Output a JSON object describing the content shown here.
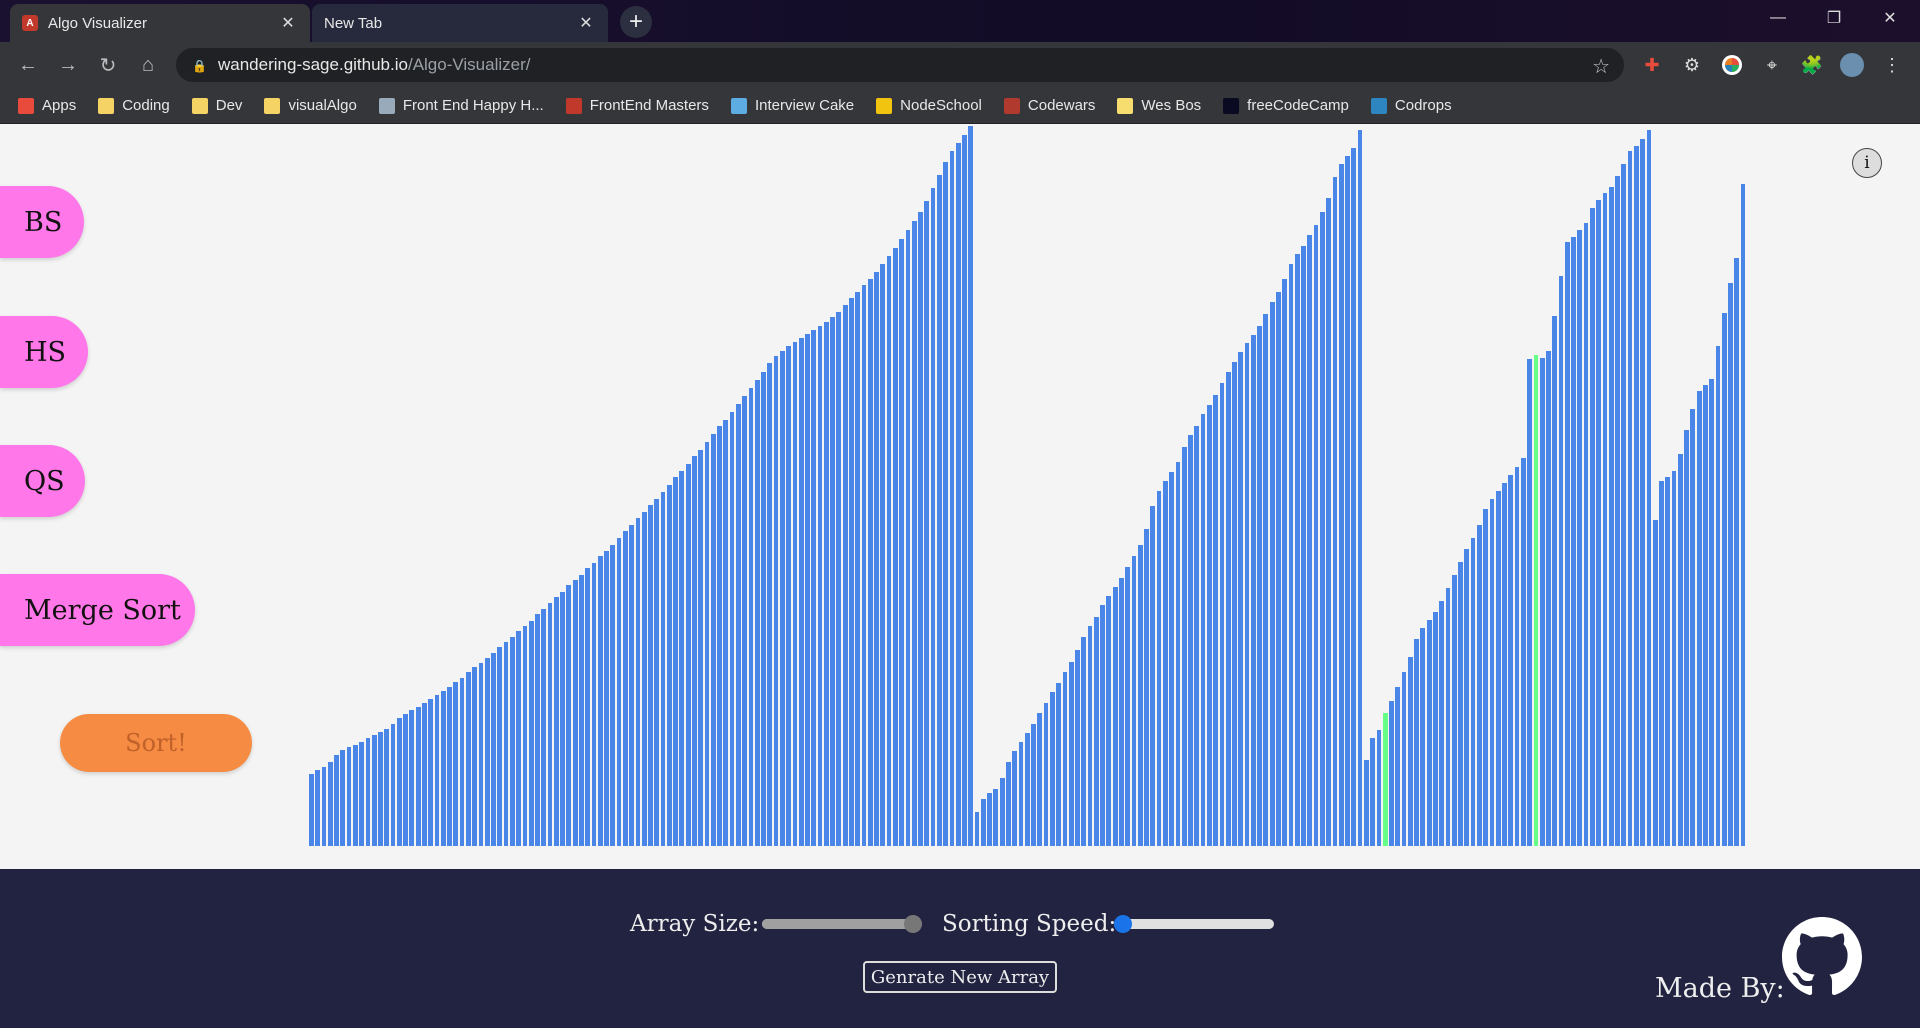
{
  "browser": {
    "active_tab": {
      "title": "Algo Visualizer",
      "favicon": "algo-visualizer-favicon"
    },
    "inactive_tab": {
      "title": "New Tab"
    },
    "url_host": "wandering-sage.github.io",
    "url_path": "/Algo-Visualizer/",
    "bookmarks": [
      {
        "label": "Apps",
        "icon": "apps-grid-icon",
        "color": "#e84b3c"
      },
      {
        "label": "Coding",
        "icon": "folder-icon",
        "color": "#f6d365"
      },
      {
        "label": "Dev",
        "icon": "folder-icon",
        "color": "#f6d365"
      },
      {
        "label": "visualAlgo",
        "icon": "folder-icon",
        "color": "#f6d365"
      },
      {
        "label": "Front End Happy H...",
        "icon": "glasses-icon",
        "color": "#9ab"
      },
      {
        "label": "FrontEnd Masters",
        "icon": "frontend-masters-icon",
        "color": "#c0392b"
      },
      {
        "label": "Interview Cake",
        "icon": "cake-icon",
        "color": "#5dade2"
      },
      {
        "label": "NodeSchool",
        "icon": "hexagon-icon",
        "color": "#f1c40f"
      },
      {
        "label": "Codewars",
        "icon": "codewars-icon",
        "color": "#b03a2e"
      },
      {
        "label": "Wes Bos",
        "icon": "crown-icon",
        "color": "#f7dc6f"
      },
      {
        "label": "freeCodeCamp",
        "icon": "freecodecamp-icon",
        "color": "#0a0a23"
      },
      {
        "label": "Codrops",
        "icon": "drop-icon",
        "color": "#2e86c1"
      }
    ]
  },
  "app": {
    "algo_buttons": [
      "BS",
      "HS",
      "QS",
      "Merge Sort"
    ],
    "sort_label": "Sort!",
    "info_label": "i",
    "colors": {
      "bar": "#4a86e8",
      "highlight": "#66ff88",
      "algo_button": "#ff77e9",
      "sort_button": "#f68c44",
      "footer": "#222340"
    },
    "bar_values": [
      55,
      58,
      60,
      64,
      69,
      73,
      75,
      77,
      79,
      82,
      84,
      87,
      89,
      93,
      97,
      100,
      103,
      106,
      109,
      112,
      115,
      118,
      121,
      125,
      128,
      132,
      136,
      139,
      143,
      147,
      151,
      155,
      159,
      163,
      167,
      171,
      176,
      180,
      185,
      189,
      193,
      198,
      202,
      206,
      211,
      215,
      220,
      224,
      229,
      234,
      239,
      244,
      249,
      254,
      259,
      264,
      269,
      274,
      280,
      285,
      290,
      296,
      301,
      307,
      313,
      319,
      324,
      330,
      336,
      342,
      348,
      354,
      360,
      367,
      372,
      376,
      380,
      383,
      386,
      389,
      392,
      395,
      398,
      402,
      406,
      411,
      416,
      421,
      426,
      431,
      436,
      442,
      448,
      454,
      461,
      468,
      475,
      482,
      490,
      500,
      510,
      520,
      528,
      534,
      540,
      547,
      26,
      36,
      40,
      43,
      52,
      64,
      72,
      79,
      86,
      93,
      101,
      109,
      117,
      124,
      132,
      140,
      149,
      159,
      167,
      174,
      183,
      190,
      197,
      204,
      212,
      220,
      229,
      241,
      258,
      270,
      277,
      284,
      292,
      303,
      312,
      319,
      328,
      335,
      343,
      352,
      360,
      368,
      375,
      382,
      388,
      395,
      404,
      413,
      421,
      431,
      442,
      450,
      456,
      464,
      472,
      482,
      492,
      508,
      518,
      524,
      530,
      544,
      65,
      82,
      88,
      101,
      110,
      121,
      132,
      144,
      157,
      166,
      172,
      178,
      186,
      196,
      206,
      216,
      226,
      234,
      244,
      256,
      264,
      270,
      276,
      282,
      288,
      295,
      370,
      373,
      371,
      376,
      403,
      433,
      459,
      463,
      468,
      473,
      485,
      491,
      496,
      501,
      509,
      518,
      528,
      532,
      537,
      544,
      248,
      277,
      280,
      285,
      298,
      316,
      332,
      346,
      350,
      355,
      380,
      405,
      428,
      447,
      503
    ],
    "highlight_indices": [
      171,
      195
    ],
    "controls": {
      "array_size_label": "Array Size:",
      "array_size_value": 1.0,
      "sorting_speed_label": "Sorting Speed:",
      "sorting_speed_value": 0.0,
      "generate_label": "Genrate New Array",
      "made_by_label": "Made By:"
    }
  }
}
